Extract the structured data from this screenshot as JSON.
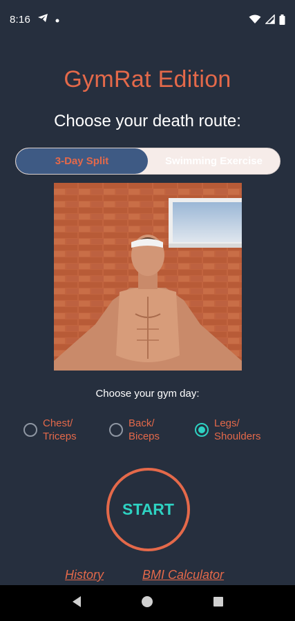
{
  "status_bar": {
    "time": "8:16",
    "icons": [
      "telegram-icon",
      "notification-dot-icon",
      "wifi-icon",
      "signal-icon",
      "battery-icon"
    ]
  },
  "app": {
    "title": "GymRat Edition",
    "subtitle": "Choose your death route:"
  },
  "segmented": {
    "options": [
      "3-Day Split",
      "Swimming Exercise"
    ],
    "selected": "3-Day Split"
  },
  "gym_day": {
    "label": "Choose your gym day:",
    "options": [
      {
        "line1": "Chest/",
        "line2": "Triceps",
        "checked": false
      },
      {
        "line1": "Back/",
        "line2": "Biceps",
        "checked": false
      },
      {
        "line1": "Legs/",
        "line2": "Shoulders",
        "checked": true
      }
    ]
  },
  "start_label": "START",
  "links": {
    "history": "History",
    "bmi": "BMI Calculator"
  },
  "nav": {
    "icons": [
      "back-icon",
      "home-icon",
      "recents-icon"
    ]
  },
  "colors": {
    "background": "#262f3e",
    "accent": "#e4694a",
    "teal": "#2ed2c2",
    "segment_active": "#3e5a84"
  }
}
